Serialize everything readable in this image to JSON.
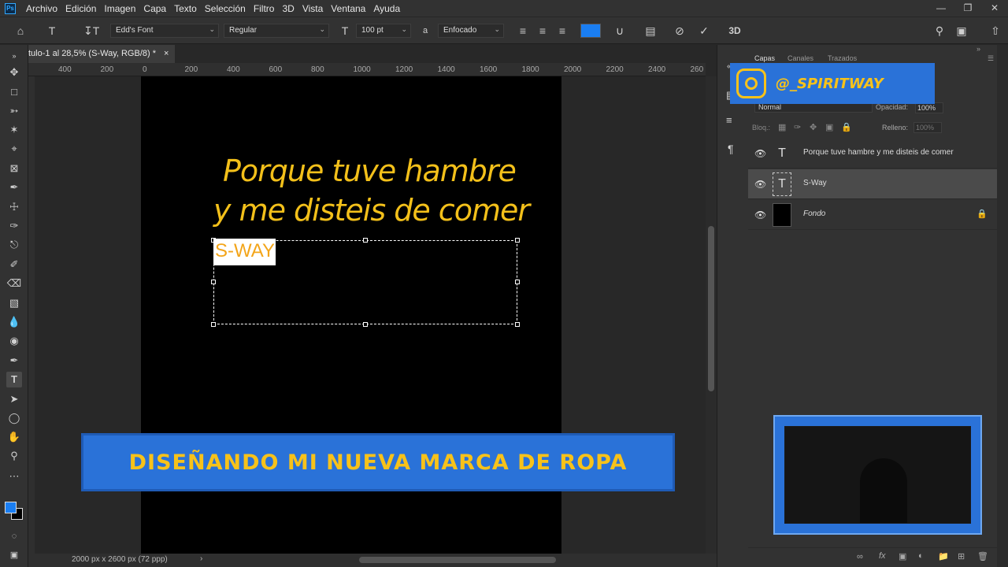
{
  "menubar": {
    "logo": "Ps",
    "items": [
      "Archivo",
      "Edición",
      "Imagen",
      "Capa",
      "Texto",
      "Selección",
      "Filtro",
      "3D",
      "Vista",
      "Ventana",
      "Ayuda"
    ]
  },
  "options": {
    "font_family": "Edd's Font",
    "font_style": "Regular",
    "font_size": "100 pt",
    "antialias": "Enfocado",
    "text_color": "#1a7ef2",
    "mode_3d": "3D"
  },
  "document": {
    "tab_title": "tulo-1 al 28,5% (S-Way, RGB/8) *",
    "close": "×",
    "status": "2000 px x 2600 px (72 ppp)"
  },
  "ruler_ticks": [
    "400",
    "200",
    "0",
    "200",
    "400",
    "600",
    "800",
    "1000",
    "1200",
    "1400",
    "1600",
    "1800",
    "2000",
    "2200",
    "2400",
    "260"
  ],
  "canvas": {
    "line1": "Porque tuve hambre",
    "line2": "y me disteis de comer",
    "edit_text": "S-WAY"
  },
  "overlay": {
    "banner": "DISEÑANDO MI NUEVA MARCA DE ROPA",
    "instagram": "@_SPIRITWAY"
  },
  "panel": {
    "tabs": [
      "Capas",
      "Canales",
      "Trazados"
    ],
    "blend_mode": "Normal",
    "opacity_label": "Opacidad:",
    "opacity": "100%",
    "lock_label": "Bloq.:",
    "fill_label": "Relleno:",
    "fill": "100%",
    "layers": [
      {
        "name": "Porque tuve hambre y me disteis de comer",
        "kind": "text"
      },
      {
        "name": "S-Way",
        "kind": "text"
      },
      {
        "name": "Fondo",
        "kind": "background"
      }
    ]
  },
  "colors": {
    "accent_blue": "#2a72d8",
    "gold": "#f3c01a"
  }
}
